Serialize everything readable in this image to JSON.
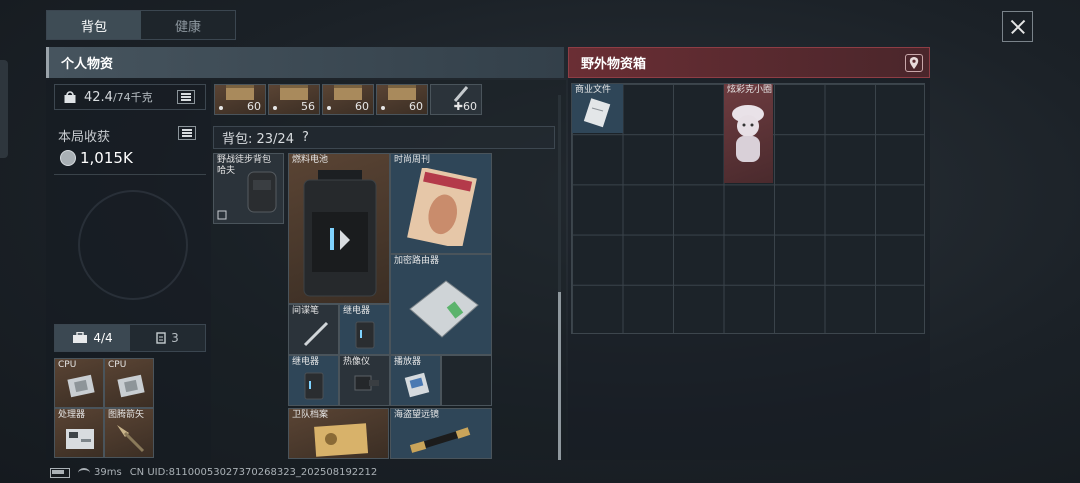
{
  "tabs": {
    "backpack": "背包",
    "health": "健康"
  },
  "left_header": "个人物资",
  "right_header": "野外物资箱",
  "weight": {
    "current": "42.4",
    "max": "/74千克"
  },
  "earnings": {
    "label": "本局收获",
    "value": "1,015K"
  },
  "container_tabs": {
    "slots": "4/4",
    "count": "3"
  },
  "pockets": [
    {
      "label": "CPU",
      "color": "brown"
    },
    {
      "label": "CPU",
      "color": "brown"
    },
    {
      "label": "处理器",
      "color": "brown"
    },
    {
      "label": "图腾箭矢",
      "color": "brown"
    }
  ],
  "ammo_row": [
    {
      "qty": "60"
    },
    {
      "qty": "56"
    },
    {
      "qty": "60"
    },
    {
      "qty": "60"
    },
    {
      "qty": "60",
      "plus": "✚"
    }
  ],
  "bag": {
    "label": "背包: 23/24",
    "help": "?"
  },
  "bag_items": {
    "backpack": "野战徒步背包",
    "backpack_sub": "哈夫",
    "battery": "燃料电池",
    "magazine": "时尚周刊",
    "router": "加密路由器",
    "spy_pen": "间谍笔",
    "relay1": "继电器",
    "relay2": "继电器",
    "thermal": "热像仪",
    "player": "播放器",
    "guard_file": "卫队档案",
    "telescope": "海盗望远镜"
  },
  "loot_items": {
    "documents": "商业文件",
    "figure": "炫彩克小圈"
  },
  "status": {
    "ping": "39ms",
    "uid": "CN UID:8110005302737026832​3_202508192212"
  },
  "colors": {
    "accent_red": "#6a2e34",
    "brown_slot": "#5a4434",
    "blue_slot": "#2f4658"
  }
}
